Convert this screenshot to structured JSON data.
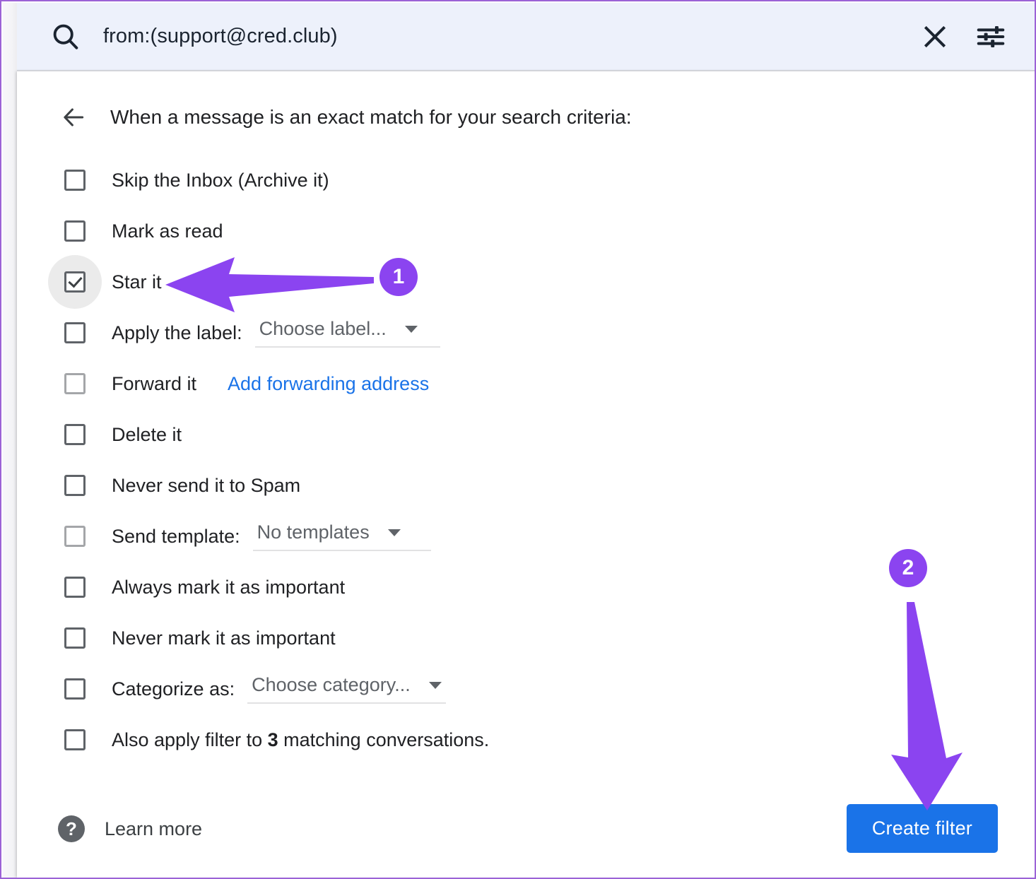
{
  "search": {
    "query": "from:(support@cred.club)",
    "icons": {
      "search": "search-icon",
      "close": "close-icon",
      "tune": "tune-icon"
    }
  },
  "panel": {
    "back_icon": "back-arrow-icon",
    "title": "When a message is an exact match for your search criteria:",
    "options": [
      {
        "label": "Skip the Inbox (Archive it)",
        "checked": false,
        "dim": false
      },
      {
        "label": "Mark as read",
        "checked": false,
        "dim": false
      },
      {
        "label": "Star it",
        "checked": true,
        "dim": false
      },
      {
        "label": "Apply the label:",
        "checked": false,
        "dim": false,
        "dropdown": "Choose label..."
      },
      {
        "label": "Forward it",
        "checked": false,
        "dim": true,
        "link": "Add forwarding address"
      },
      {
        "label": "Delete it",
        "checked": false,
        "dim": false
      },
      {
        "label": "Never send it to Spam",
        "checked": false,
        "dim": false
      },
      {
        "label": "Send template:",
        "checked": false,
        "dim": true,
        "dropdown": "No templates"
      },
      {
        "label": "Always mark it as important",
        "checked": false,
        "dim": false
      },
      {
        "label": "Never mark it as important",
        "checked": false,
        "dim": false
      },
      {
        "label": "Categorize as:",
        "checked": false,
        "dim": false,
        "dropdown": "Choose category..."
      },
      {
        "label": "Also apply filter to 3 matching conversations.",
        "checked": false,
        "dim": false,
        "rich": [
          "Also apply filter to ",
          "3",
          " matching conversations."
        ]
      }
    ]
  },
  "footer": {
    "help_icon": "question-mark-icon",
    "learn_more": "Learn more",
    "create_filter": "Create filter"
  },
  "annotations": {
    "accent_color": "#8b44f0",
    "markers": [
      {
        "number": "1",
        "arrow": "arrow-left"
      },
      {
        "number": "2",
        "arrow": "arrow-down"
      }
    ]
  },
  "colors": {
    "search_bar_bg": "#edf1fb",
    "link_blue": "#1a73e8",
    "button_blue": "#1a73e8",
    "text_primary": "#202124",
    "text_secondary": "#5f6368",
    "frame_border": "#9b62d6"
  }
}
